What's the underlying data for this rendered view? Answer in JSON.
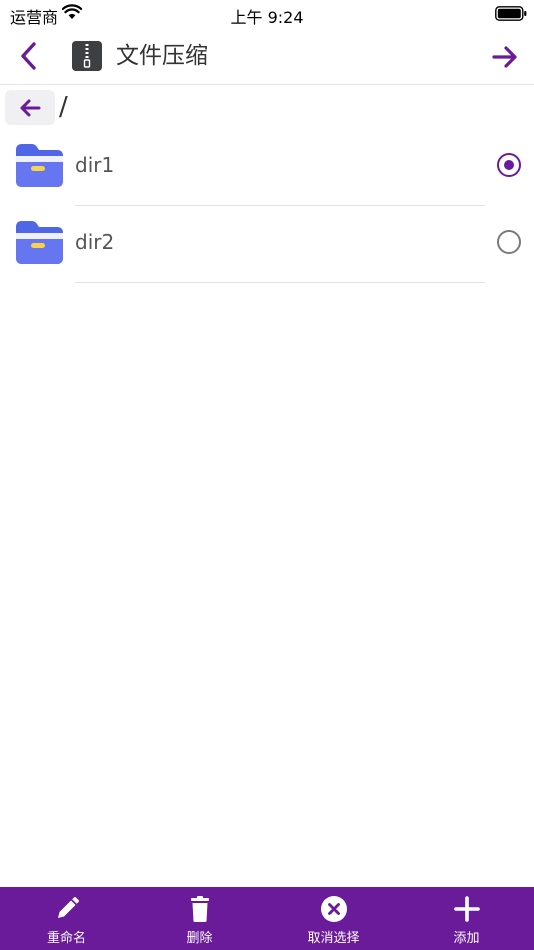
{
  "status_bar": {
    "carrier": "运营商",
    "time": "上午 9:24"
  },
  "nav": {
    "title": "文件压缩",
    "accent_color": "#6a1b9a"
  },
  "path": {
    "current": "/"
  },
  "files": [
    {
      "name": "dir1",
      "selected": true,
      "icon": "folder-icon"
    },
    {
      "name": "dir2",
      "selected": false,
      "icon": "folder-icon"
    }
  ],
  "toolbar": {
    "background": "#6a1b9a",
    "items": [
      {
        "label": "重命名",
        "icon": "pencil-icon"
      },
      {
        "label": "删除",
        "icon": "trash-icon"
      },
      {
        "label": "取消选择",
        "icon": "close-circle-icon"
      },
      {
        "label": "添加",
        "icon": "plus-icon"
      }
    ]
  }
}
